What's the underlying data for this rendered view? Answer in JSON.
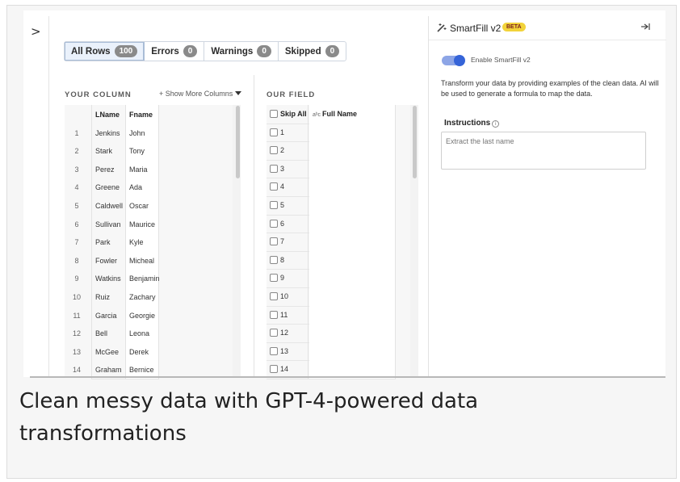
{
  "sidebar": {
    "expand_glyph": ">"
  },
  "tabs": [
    {
      "label": "All Rows",
      "count": "100",
      "active": true
    },
    {
      "label": "Errors",
      "count": "0",
      "active": false
    },
    {
      "label": "Warnings",
      "count": "0",
      "active": false
    },
    {
      "label": "Skipped",
      "count": "0",
      "active": false
    }
  ],
  "left": {
    "section_label": "YOUR COLUMN",
    "show_more": "+ Show More Columns",
    "headers": [
      "LName",
      "Fname"
    ],
    "rows": [
      [
        "1",
        "Jenkins",
        "John"
      ],
      [
        "2",
        "Stark",
        "Tony"
      ],
      [
        "3",
        "Perez",
        "Maria"
      ],
      [
        "4",
        "Greene",
        "Ada"
      ],
      [
        "5",
        "Caldwell",
        "Oscar"
      ],
      [
        "6",
        "Sullivan",
        "Maurice"
      ],
      [
        "7",
        "Park",
        "Kyle"
      ],
      [
        "8",
        "Fowler",
        "Micheal"
      ],
      [
        "9",
        "Watkins",
        "Benjamin"
      ],
      [
        "10",
        "Ruiz",
        "Zachary"
      ],
      [
        "11",
        "Garcia",
        "Georgie"
      ],
      [
        "12",
        "Bell",
        "Leona"
      ],
      [
        "13",
        "McGee",
        "Derek"
      ],
      [
        "14",
        "Graham",
        "Bernice"
      ]
    ]
  },
  "right": {
    "section_label": "OUR FIELD",
    "skip_all": "Skip All",
    "type_glyph": "aᵇc",
    "field_header": "Full Name",
    "rows": [
      "1",
      "2",
      "3",
      "4",
      "5",
      "6",
      "7",
      "8",
      "9",
      "10",
      "11",
      "12",
      "13",
      "14"
    ]
  },
  "panel": {
    "title": "SmartFill v2",
    "badge": "BETA",
    "wand_icon": "⁄",
    "collapse_icon": "⇥",
    "toggle_label": "Enable SmartFill v2",
    "toggle_on": true,
    "description": "Transform your data by providing examples of the clean data. AI will be used to generate a formula to map the data.",
    "instructions_label": "Instructions",
    "instructions_value": "Extract the last name"
  },
  "caption": "Clean messy data with GPT-4-powered data transformations",
  "colors": {
    "accent": "#3564d8",
    "badge": "#f2d33a",
    "pill": "#8a8a8a"
  }
}
